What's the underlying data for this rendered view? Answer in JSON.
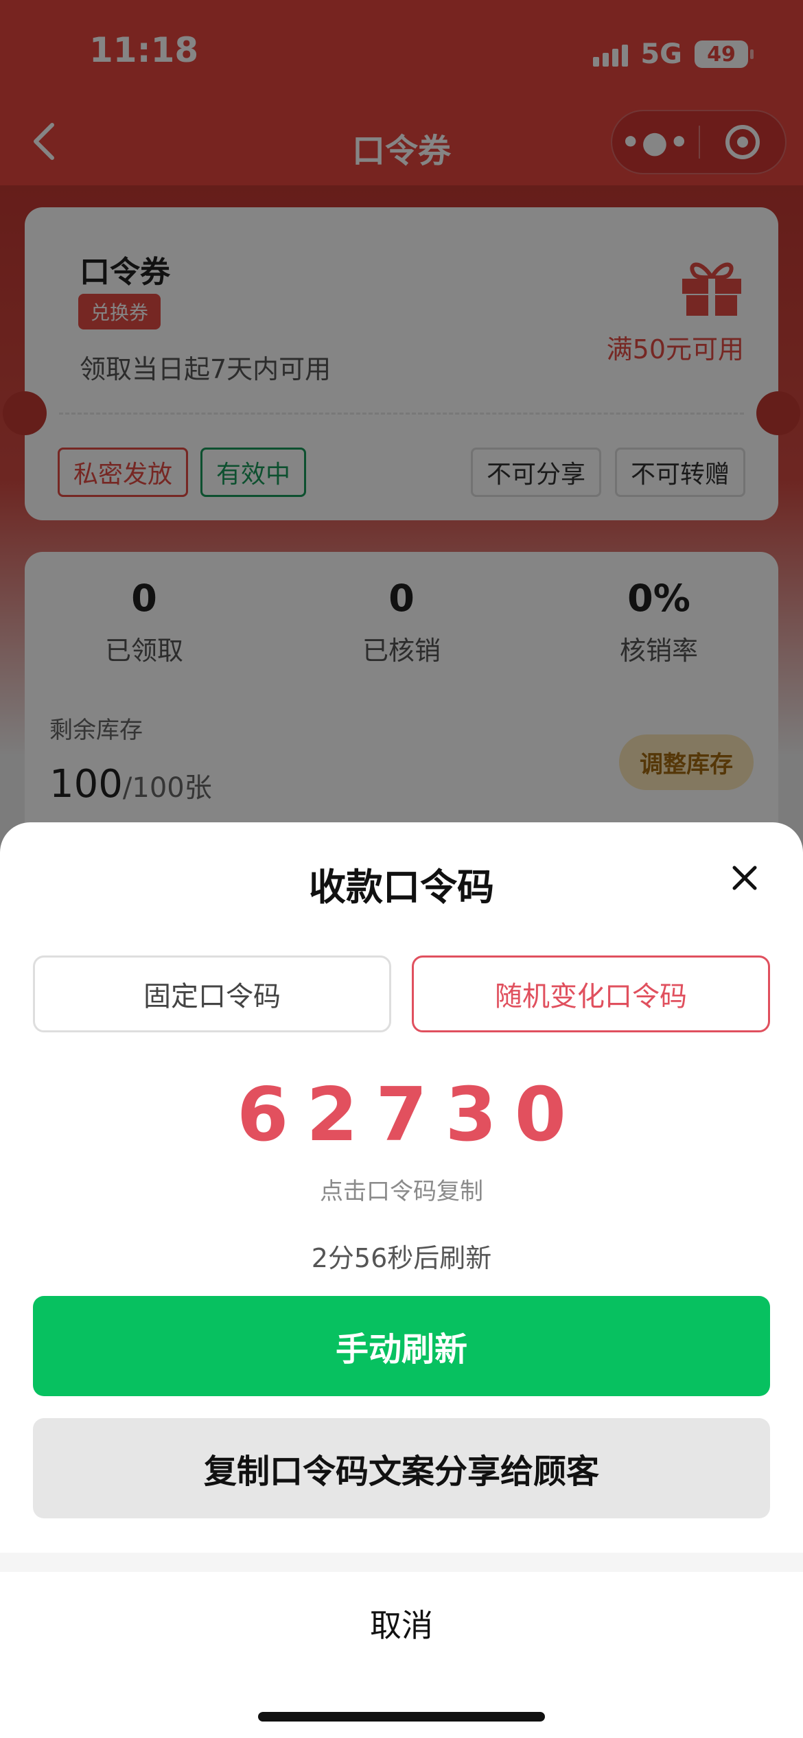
{
  "status": {
    "time": "11:18",
    "network": "5G",
    "battery": "49"
  },
  "navbar": {
    "back_icon": "chevron-left-icon",
    "title": "口令券",
    "more_icon": "more-dots-icon",
    "target_icon": "target-icon"
  },
  "coupon": {
    "name": "口令券",
    "tag": "兑换券",
    "validity": "领取当日起7天内可用",
    "condition": "满50元可用",
    "icon": "gift-icon",
    "badges": {
      "private": "私密发放",
      "active": "有效中",
      "no_share": "不可分享",
      "no_transfer": "不可转赠"
    },
    "accent": "#e34b44"
  },
  "stats": {
    "received": {
      "value": "0",
      "label": "已领取"
    },
    "redeemed": {
      "value": "0",
      "label": "已核销"
    },
    "rate": {
      "value": "0%",
      "label": "核销率"
    },
    "stock_label": "剩余库存",
    "stock_remaining": "100",
    "stock_sep": "/",
    "stock_total": "100张",
    "adjust_label": "调整库存"
  },
  "sheet": {
    "title": "收款口令码",
    "close_icon": "close-icon",
    "tabs": {
      "fixed": "固定口令码",
      "random": "随机变化口令码",
      "selected": "random"
    },
    "code": "62730",
    "copy_hint": "点击口令码复制",
    "refresh_countdown": "2分56秒后刷新",
    "refresh_button": "手动刷新",
    "share_button": "复制口令码文案分享给顾客",
    "cancel": "取消",
    "code_color": "#e2505e",
    "primary_color": "#07c160"
  }
}
